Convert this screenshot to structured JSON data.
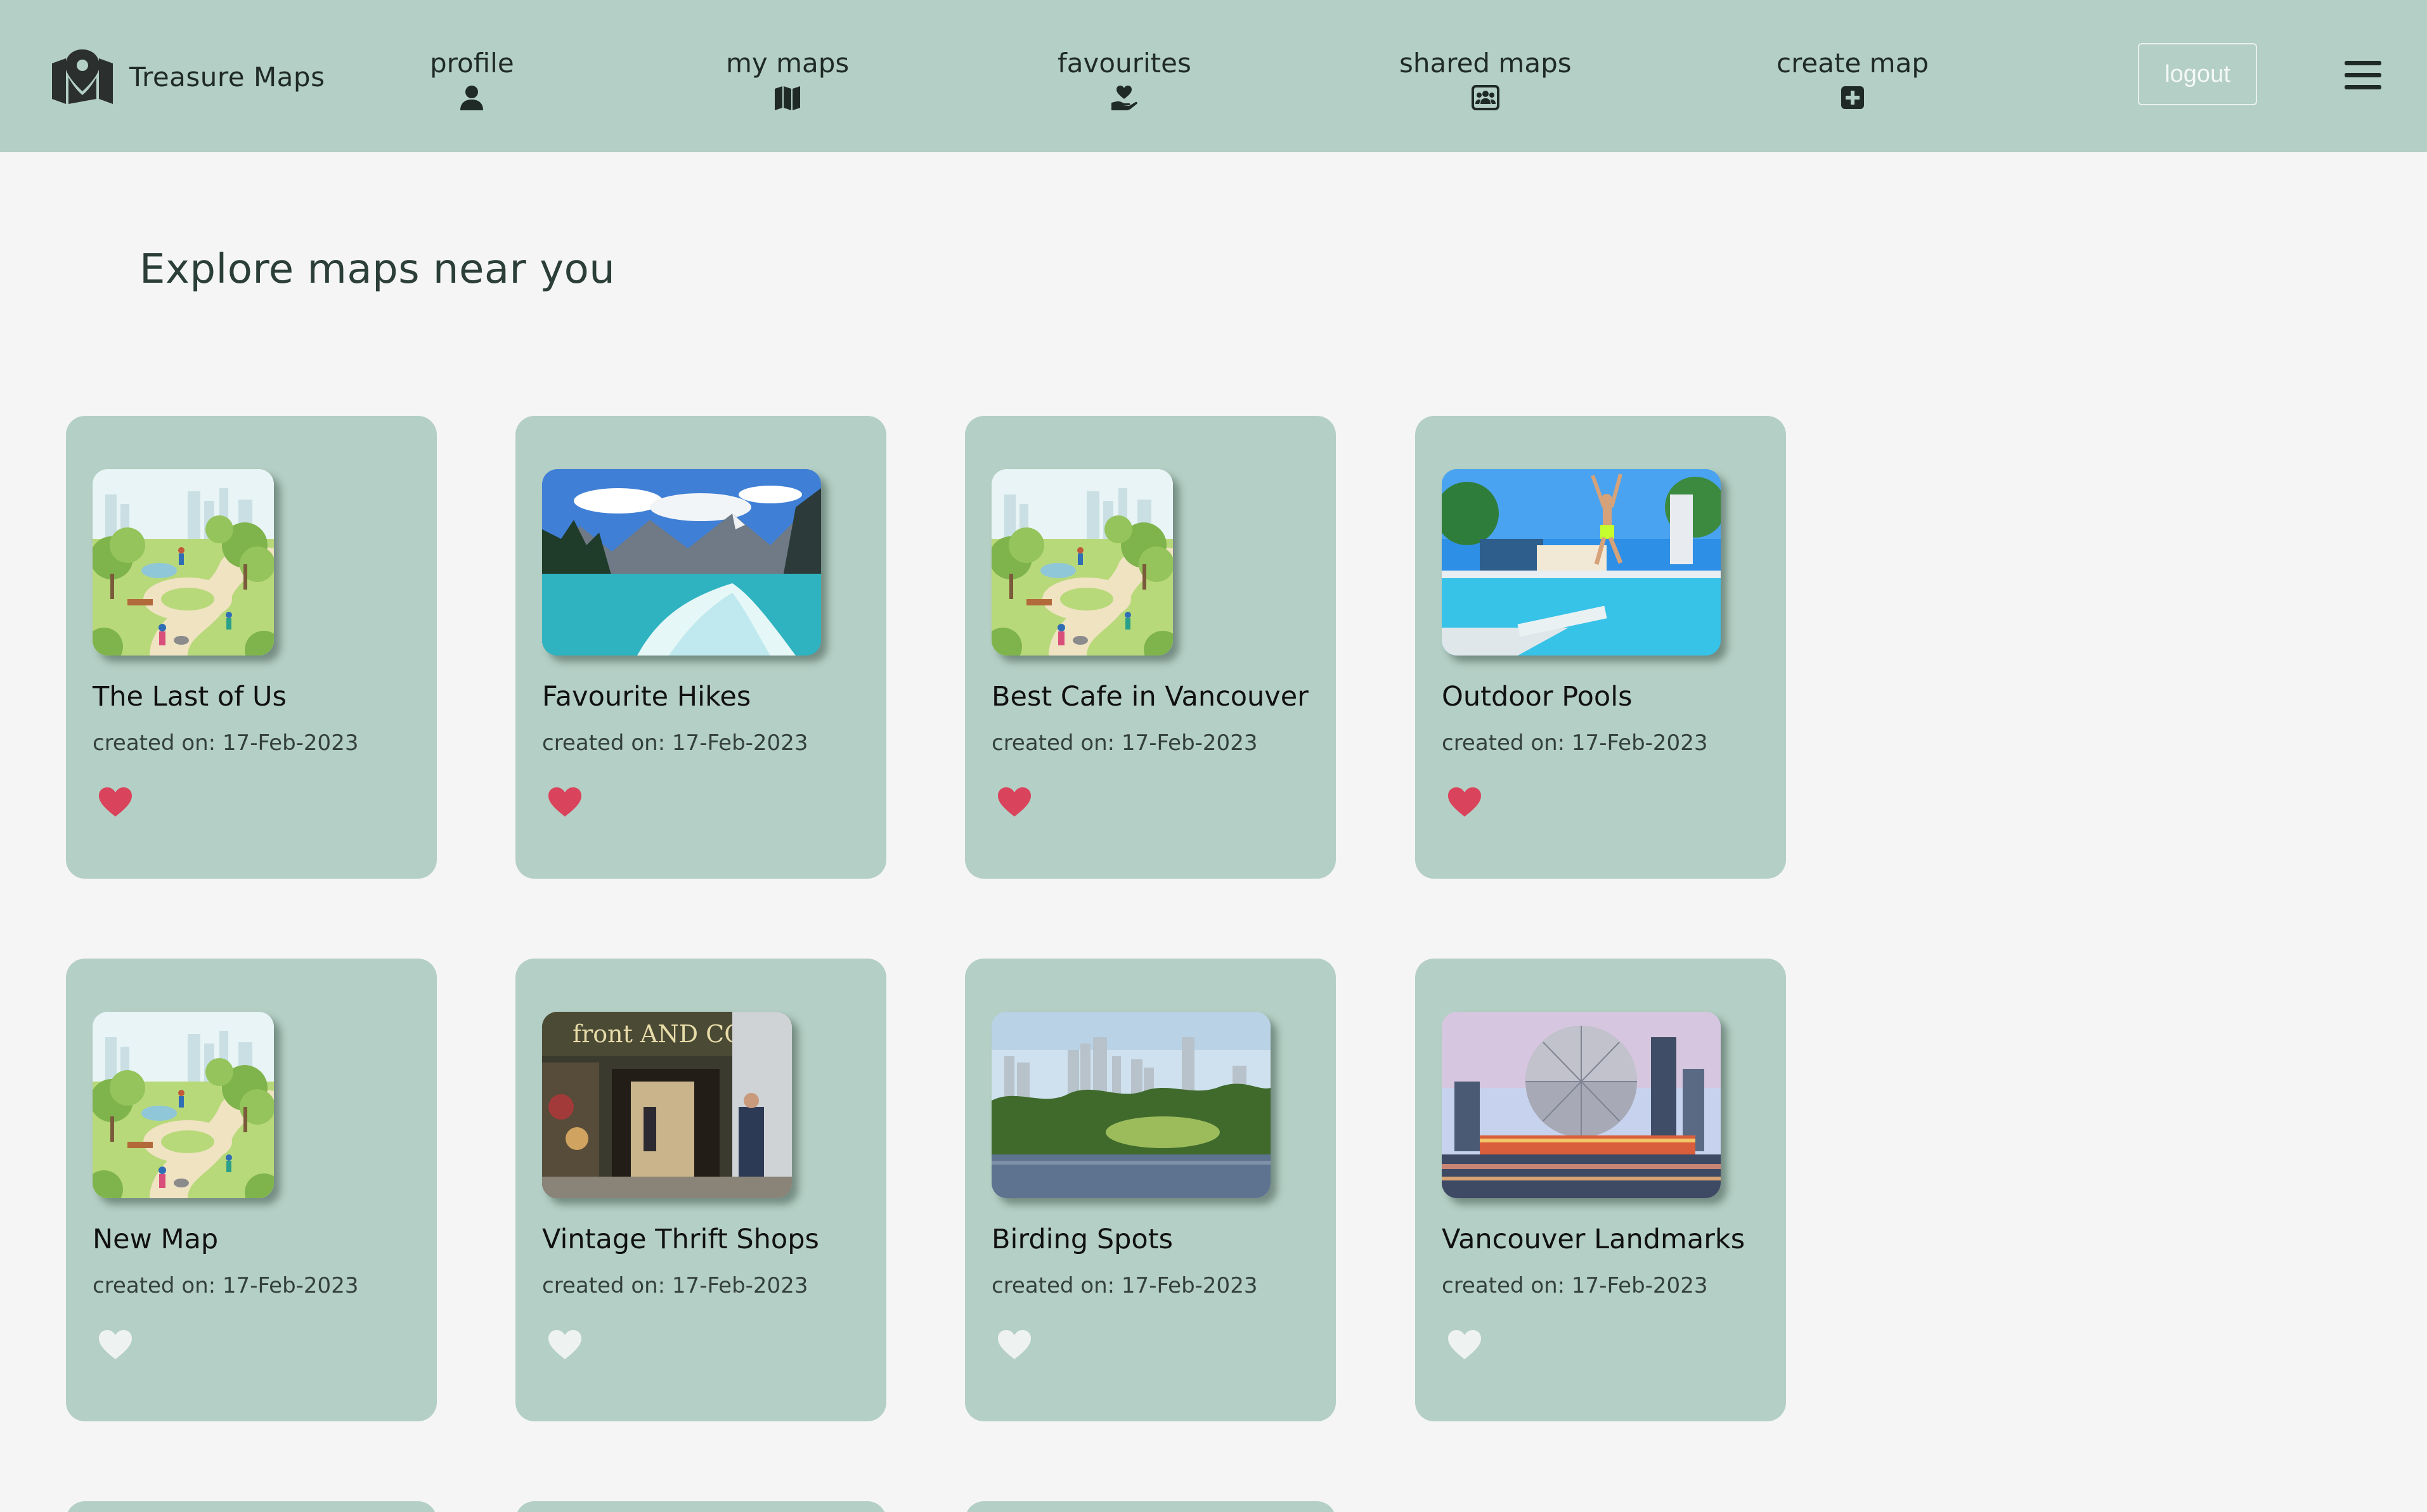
{
  "app": {
    "name": "Treasure Maps",
    "logo_icon": "map-pin-icon"
  },
  "nav": {
    "items": [
      {
        "label": "profile",
        "icon": "user-icon"
      },
      {
        "label": "my maps",
        "icon": "map-icon"
      },
      {
        "label": "favourites",
        "icon": "hand-heart-icon"
      },
      {
        "label": "shared maps",
        "icon": "users-card-icon"
      },
      {
        "label": "create map",
        "icon": "plus-square-icon"
      }
    ],
    "logout_label": "logout",
    "menu_icon": "hamburger-menu-icon"
  },
  "main": {
    "title": "Explore maps near you",
    "cards": [
      {
        "title": "The Last of Us",
        "date": "created on: 17-Feb-2023",
        "favourite": true,
        "thumbnail": "park-illustration"
      },
      {
        "title": "Favourite Hikes",
        "date": "created on: 17-Feb-2023",
        "favourite": true,
        "thumbnail": "mountain-lake-photo"
      },
      {
        "title": "Best Cafe in Vancouver",
        "date": "created on: 17-Feb-2023",
        "favourite": true,
        "thumbnail": "park-illustration"
      },
      {
        "title": "Outdoor Pools",
        "date": "created on: 17-Feb-2023",
        "favourite": true,
        "thumbnail": "pool-diver-photo"
      },
      {
        "title": "New Map",
        "date": "created on: 17-Feb-2023",
        "favourite": false,
        "thumbnail": "park-illustration"
      },
      {
        "title": "Vintage Thrift Shops",
        "date": "created on: 17-Feb-2023",
        "favourite": false,
        "thumbnail": "storefront-photo",
        "thumbnail_sign": "front AND COMPANY"
      },
      {
        "title": "Birding Spots",
        "date": "created on: 17-Feb-2023",
        "favourite": false,
        "thumbnail": "city-skyline-lake-photo"
      },
      {
        "title": "Vancouver Landmarks",
        "date": "created on: 17-Feb-2023",
        "favourite": false,
        "thumbnail": "science-world-dome-photo"
      }
    ]
  },
  "colors": {
    "navbar_bg": "#b4cfc5",
    "page_bg": "#f5f5f5",
    "card_bg": "#b4cfc5",
    "heart_active": "#d9435b",
    "heart_inactive": "#eef2f0"
  }
}
